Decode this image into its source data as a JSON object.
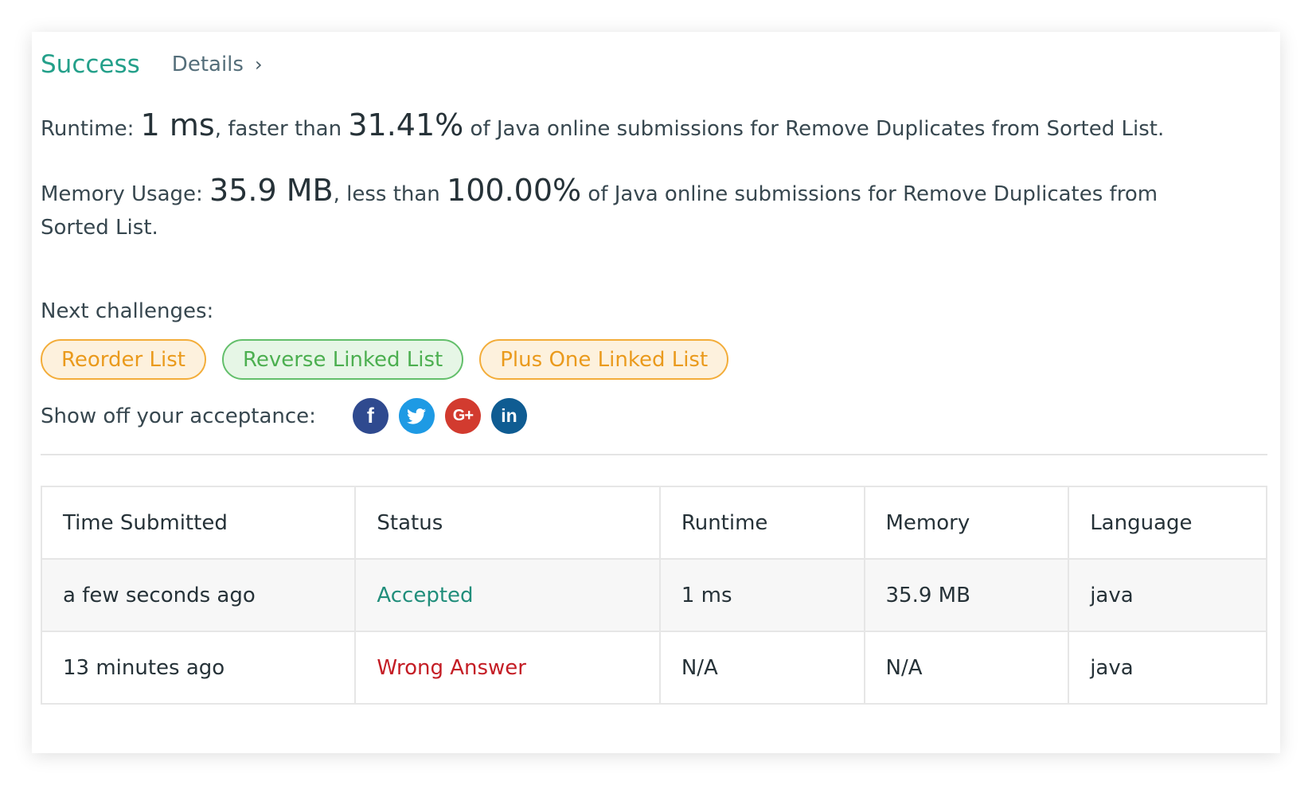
{
  "result": {
    "status": "Success",
    "details_label": "Details",
    "details_chevron": "›"
  },
  "runtime": {
    "label": "Runtime:",
    "value": "1 ms",
    "comparison": ", faster than",
    "percent": "31.41%",
    "suffix": "of Java online submissions for Remove Duplicates from Sorted List."
  },
  "memory": {
    "label": "Memory Usage:",
    "value": "35.9 MB",
    "comparison": ", less than",
    "percent": "100.00%",
    "suffix": "of Java online submissions for Remove Duplicates from Sorted List."
  },
  "next_challenges": {
    "label": "Next challenges:",
    "items": [
      {
        "label": "Reorder List",
        "difficulty": "medium"
      },
      {
        "label": "Reverse Linked List",
        "difficulty": "easy"
      },
      {
        "label": "Plus One Linked List",
        "difficulty": "medium"
      }
    ]
  },
  "share": {
    "label": "Show off your acceptance:",
    "icons": [
      {
        "name": "facebook-icon",
        "glyph": "f",
        "color": "#2f4a8f"
      },
      {
        "name": "twitter-icon",
        "glyph": "",
        "color": "#1e9ae4"
      },
      {
        "name": "google-plus-icon",
        "glyph": "G+",
        "color": "#d23b2f"
      },
      {
        "name": "linkedin-icon",
        "glyph": "in",
        "color": "#0f5c92"
      }
    ]
  },
  "submissions": {
    "headers": [
      "Time Submitted",
      "Status",
      "Runtime",
      "Memory",
      "Language"
    ],
    "rows": [
      {
        "time": "a few seconds ago",
        "status": "Accepted",
        "runtime": "1 ms",
        "memory": "35.9 MB",
        "language": "java"
      },
      {
        "time": "13 minutes ago",
        "status": "Wrong Answer",
        "runtime": "N/A",
        "memory": "N/A",
        "language": "java"
      }
    ]
  },
  "colors": {
    "success": "#24a08a",
    "accepted": "#218e7b",
    "wrong_answer": "#c41d25",
    "medium_chip": "#ea9a1c",
    "easy_chip": "#4caf50"
  }
}
